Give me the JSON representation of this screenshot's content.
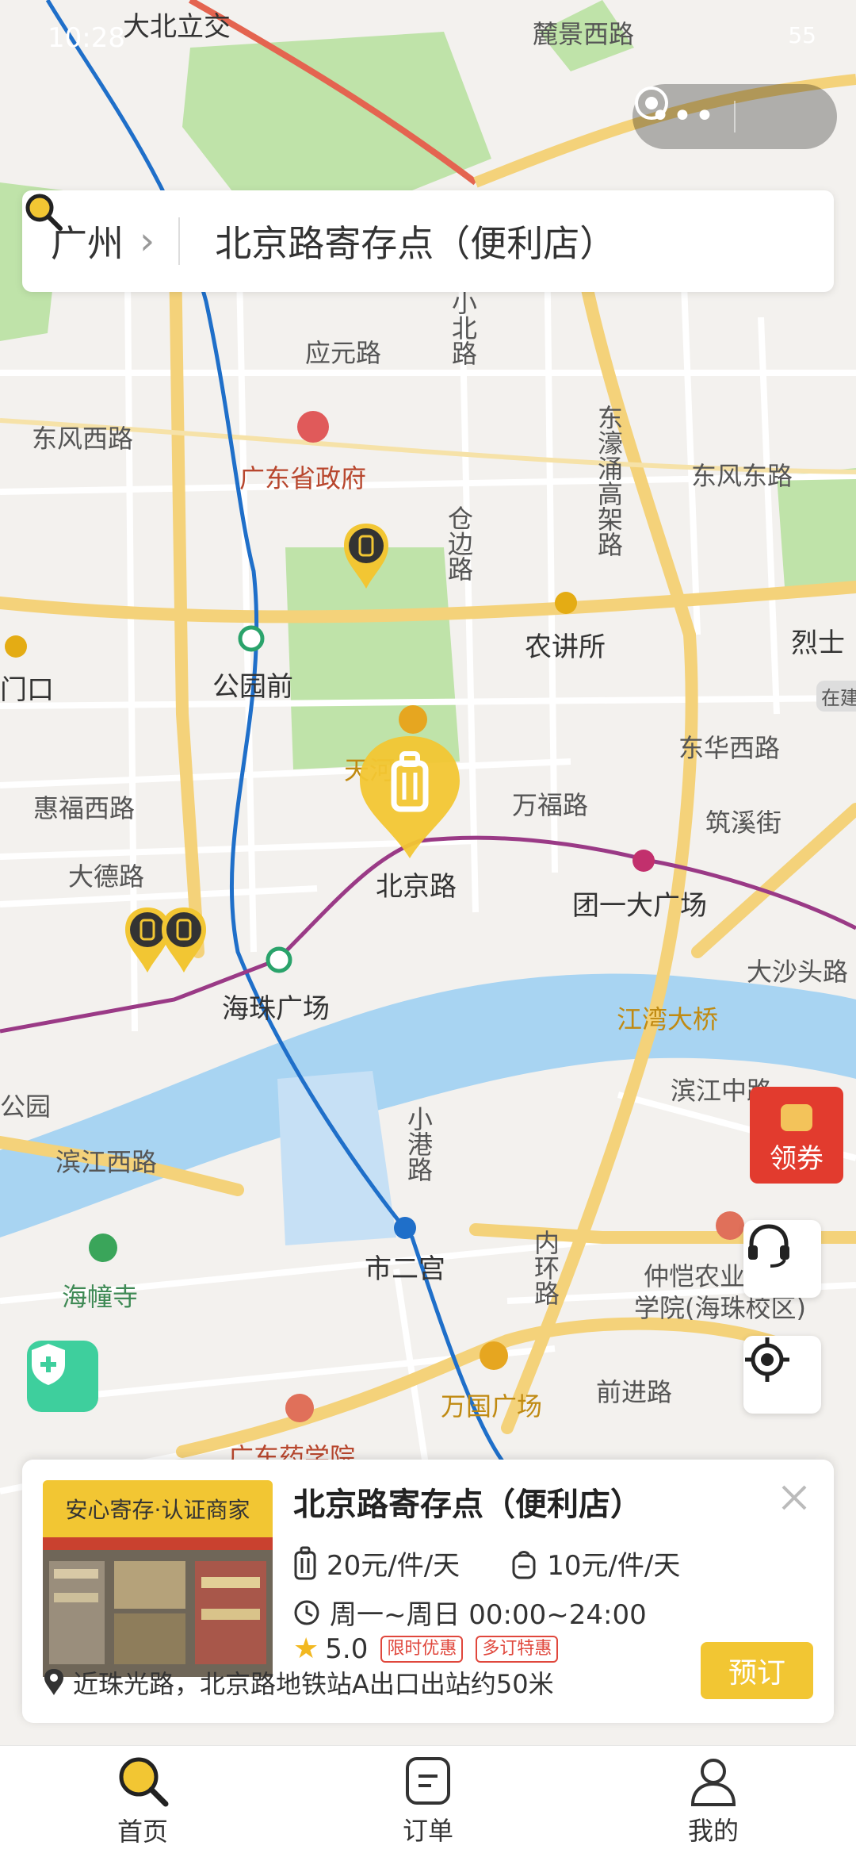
{
  "status_bar": {
    "time": "10:28",
    "battery": "55"
  },
  "search": {
    "city": "广州",
    "query": "北京路寄存点（便利店）"
  },
  "map_labels": {
    "dabeilijiao": "大北立交",
    "luojing_xilu": "麓景西路",
    "xiaobeilu": "小北路",
    "yingyuanlu": "应元路",
    "dongfeng_xilu": "东风西路",
    "dongfeng_donglu": "东风东路",
    "guangdong_zhengfu": "广东省政府",
    "cangbianlu": "仓边路",
    "donghao_gaojia": "东濠涌高架路",
    "nongjiangsuo": "农讲所",
    "lieshi": "烈士",
    "gongyuanqian": "公园前",
    "menkou": "门口",
    "zaijian": "在建",
    "donghua_xilu": "东华西路",
    "tianhe": "天河",
    "wanfulu": "万福路",
    "zhuxijie": "筑溪街",
    "huifu_xilu": "惠福西路",
    "dadelu": "大德路",
    "beijinglu": "北京路",
    "tuanyi_guangchang": "团一大广场",
    "dashatoulu": "大沙头路",
    "haizhu_guangchang": "海珠广场",
    "jiangwan_daqiao": "江湾大桥",
    "binjiang_zhonglu": "滨江中路",
    "gongyuan": "公园",
    "binjiang_xilu": "滨江西路",
    "xiaoganglu": "小港路",
    "shierguan": "市二宫",
    "neihuanlu": "内环路",
    "zhongkai": "仲恺农业",
    "zhongkai2": "学院(海珠校区)",
    "haichuangsi": "海幢寺",
    "qianjinlu": "前进路",
    "wanguo_guangchang": "万国广场",
    "guangdong_yaoxueyuan": "广东药学院"
  },
  "coupon": {
    "label": "领券"
  },
  "store": {
    "badge": "安心寄存·认证商家",
    "name": "北京路寄存点（便利店）",
    "price_luggage": "20元/件/天",
    "price_bag": "10元/件/天",
    "hours": "周一~周日 00:00~24:00",
    "rating": "5.0",
    "tags": [
      "限时优惠",
      "多订特惠"
    ],
    "address": "近珠光路，北京路地铁站A出口出站约50米",
    "book_label": "预订"
  },
  "tabs": [
    {
      "label": "首页",
      "icon": "search-icon",
      "active": true
    },
    {
      "label": "订单",
      "icon": "order-icon",
      "active": false
    },
    {
      "label": "我的",
      "icon": "user-icon",
      "active": false
    }
  ],
  "colors": {
    "accent": "#f2c633",
    "metro_blue": "#1f6fc9",
    "metro_purple": "#9a3a86",
    "river": "#a8d4f2",
    "park": "#bfe3a9"
  }
}
